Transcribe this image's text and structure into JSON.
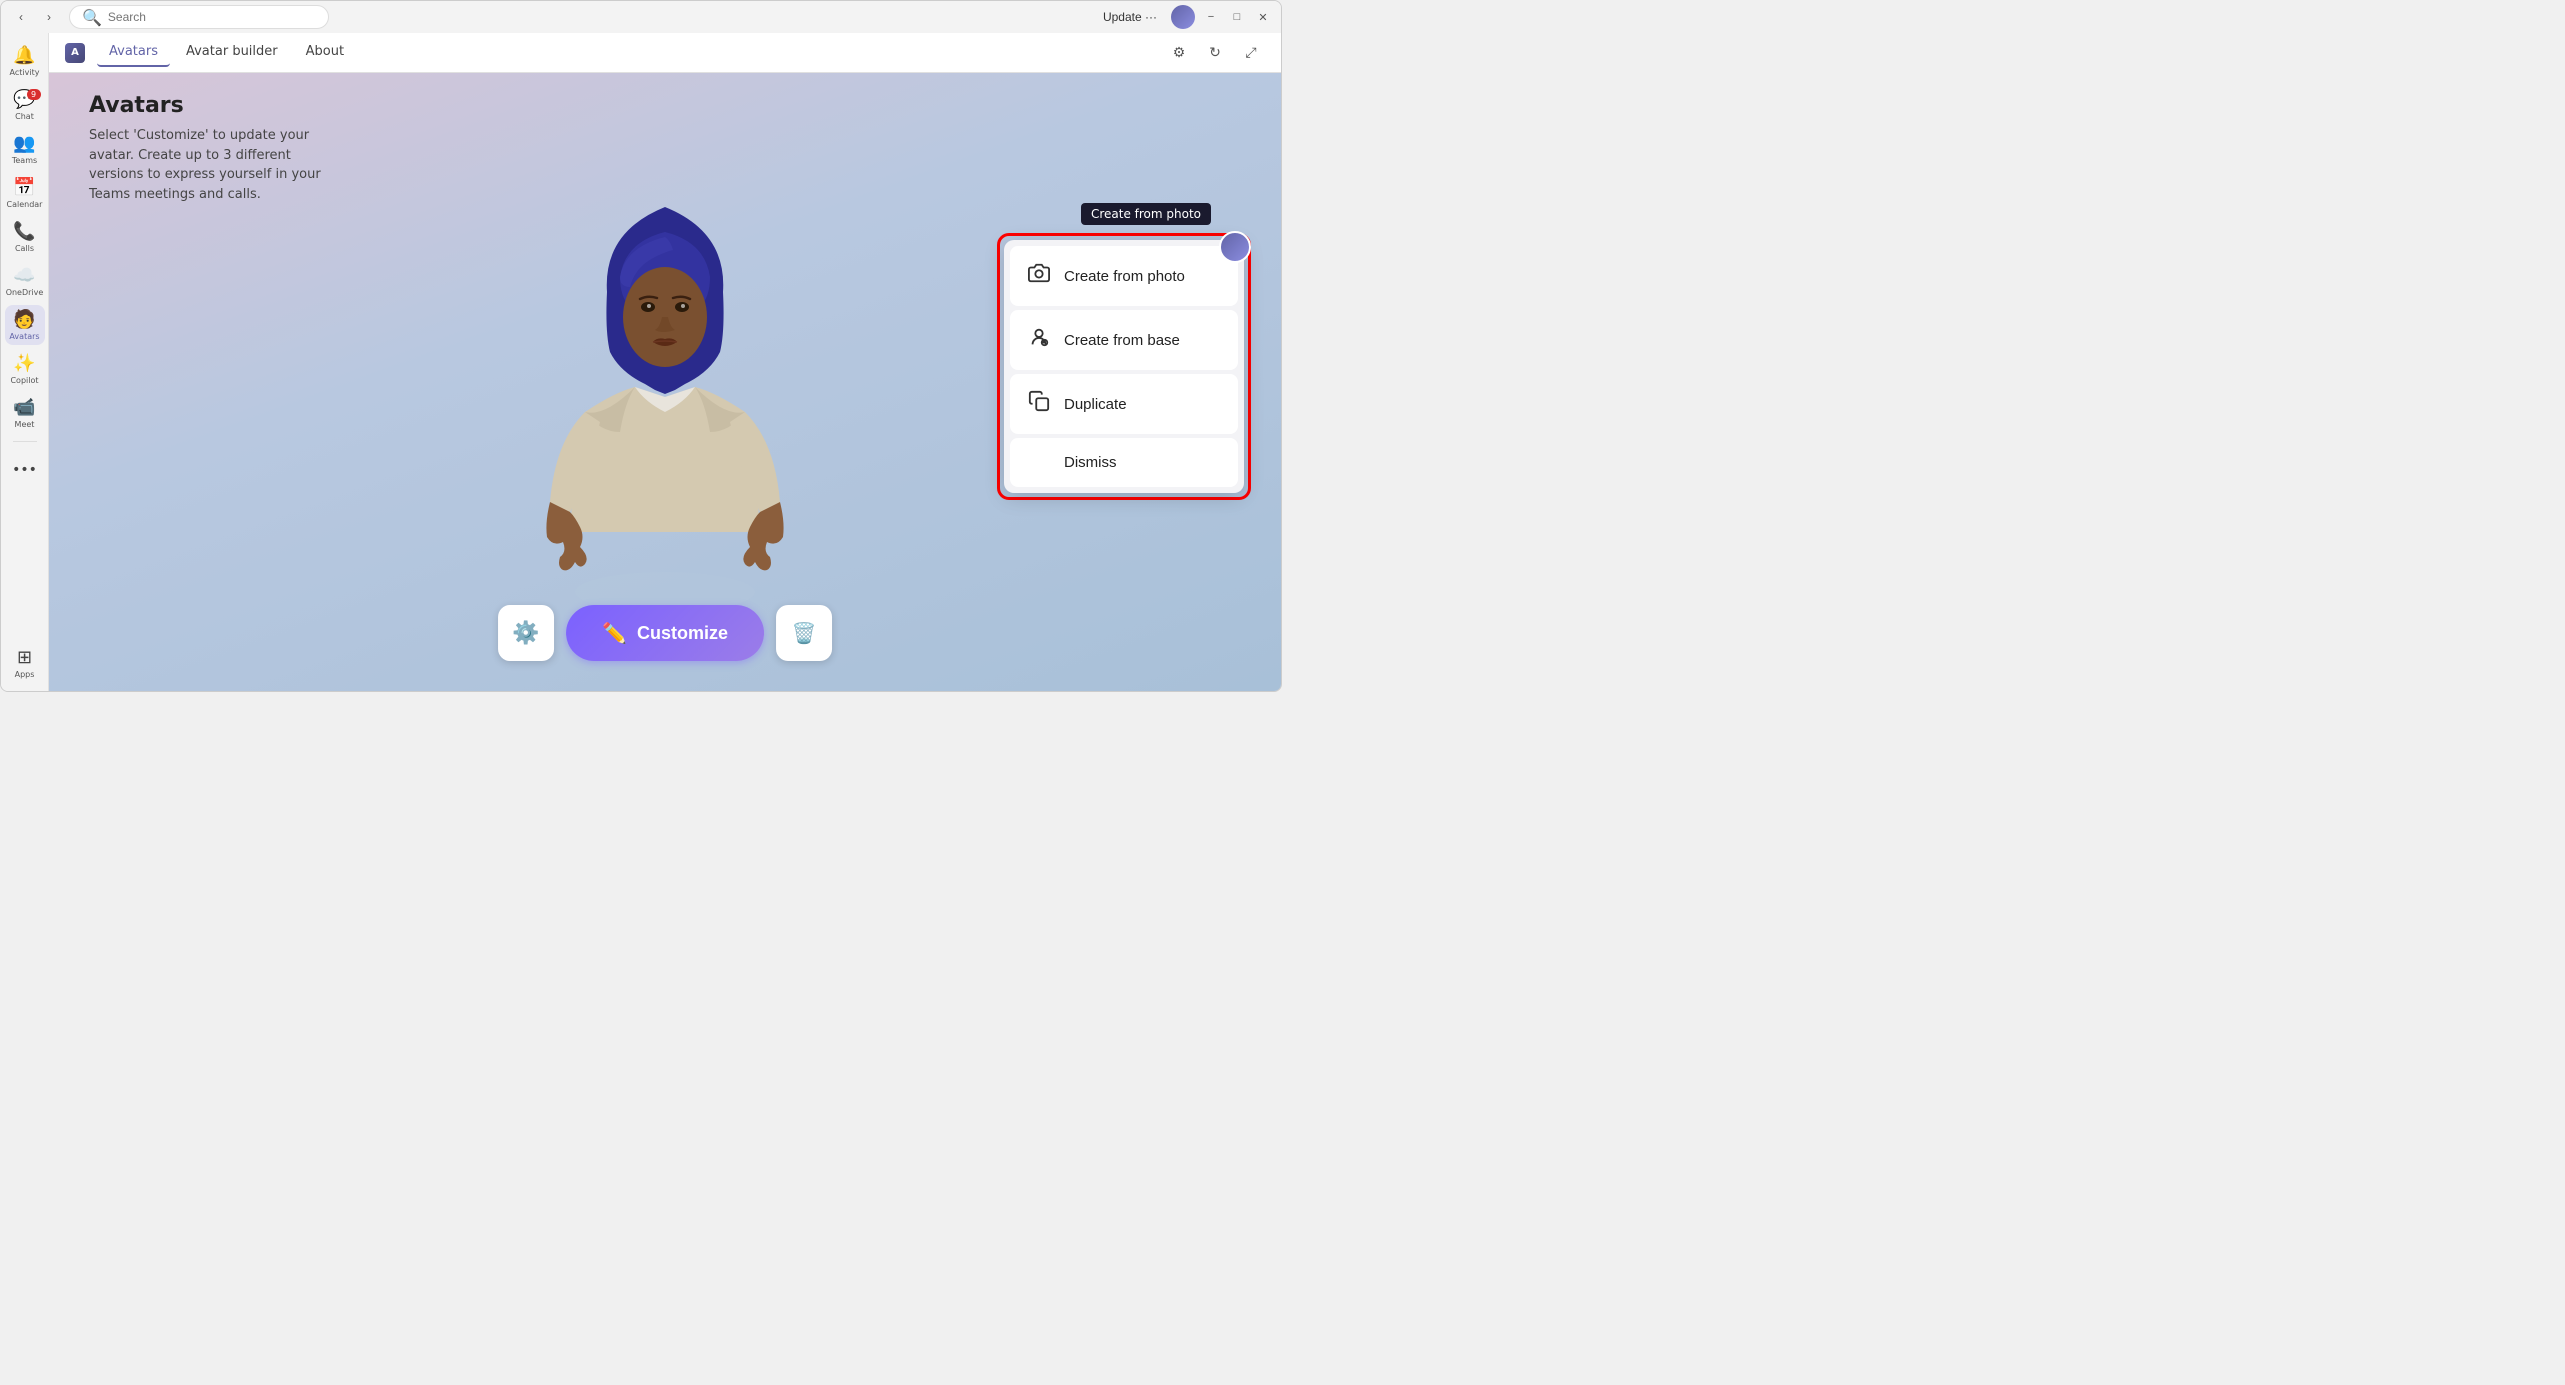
{
  "titlebar": {
    "update_label": "Update ···",
    "search_placeholder": "Search"
  },
  "tabs": {
    "app_name": "Avatars",
    "items": [
      {
        "label": "Avatars",
        "active": true
      },
      {
        "label": "Avatar builder",
        "active": false
      },
      {
        "label": "About",
        "active": false
      }
    ]
  },
  "sidebar": {
    "items": [
      {
        "label": "Activity",
        "icon": "🔔",
        "badge": null,
        "active": false
      },
      {
        "label": "Chat",
        "icon": "💬",
        "badge": "9",
        "active": false
      },
      {
        "label": "Teams",
        "icon": "👥",
        "badge": null,
        "active": false
      },
      {
        "label": "Calendar",
        "icon": "📅",
        "badge": null,
        "active": false
      },
      {
        "label": "Calls",
        "icon": "📞",
        "badge": null,
        "active": false
      },
      {
        "label": "OneDrive",
        "icon": "☁️",
        "badge": null,
        "active": false
      },
      {
        "label": "Avatars",
        "icon": "🧑",
        "badge": null,
        "active": true
      },
      {
        "label": "Copilot",
        "icon": "✨",
        "badge": null,
        "active": false
      },
      {
        "label": "Meet",
        "icon": "📹",
        "badge": null,
        "active": false
      },
      {
        "label": "···",
        "icon": "···",
        "badge": null,
        "active": false
      },
      {
        "label": "Apps",
        "icon": "⊞",
        "badge": null,
        "active": false
      }
    ]
  },
  "page": {
    "title": "Avatars",
    "description": "Select 'Customize' to update your avatar.\nCreate up to 3 different versions to express\nyourself in your Teams meetings and calls."
  },
  "toolbar": {
    "settings_label": "⚙",
    "customize_label": "Customize",
    "delete_label": "🗑"
  },
  "popup": {
    "tooltip": "Create from photo",
    "items": [
      {
        "label": "Create from photo",
        "icon": "📷"
      },
      {
        "label": "Create from base",
        "icon": "👤"
      },
      {
        "label": "Duplicate",
        "icon": "📋"
      },
      {
        "label": "Dismiss",
        "icon": null
      }
    ]
  },
  "colors": {
    "accent": "#6264a7",
    "popup_border": "#ff0000",
    "customize_bg": "#7b61ff"
  }
}
